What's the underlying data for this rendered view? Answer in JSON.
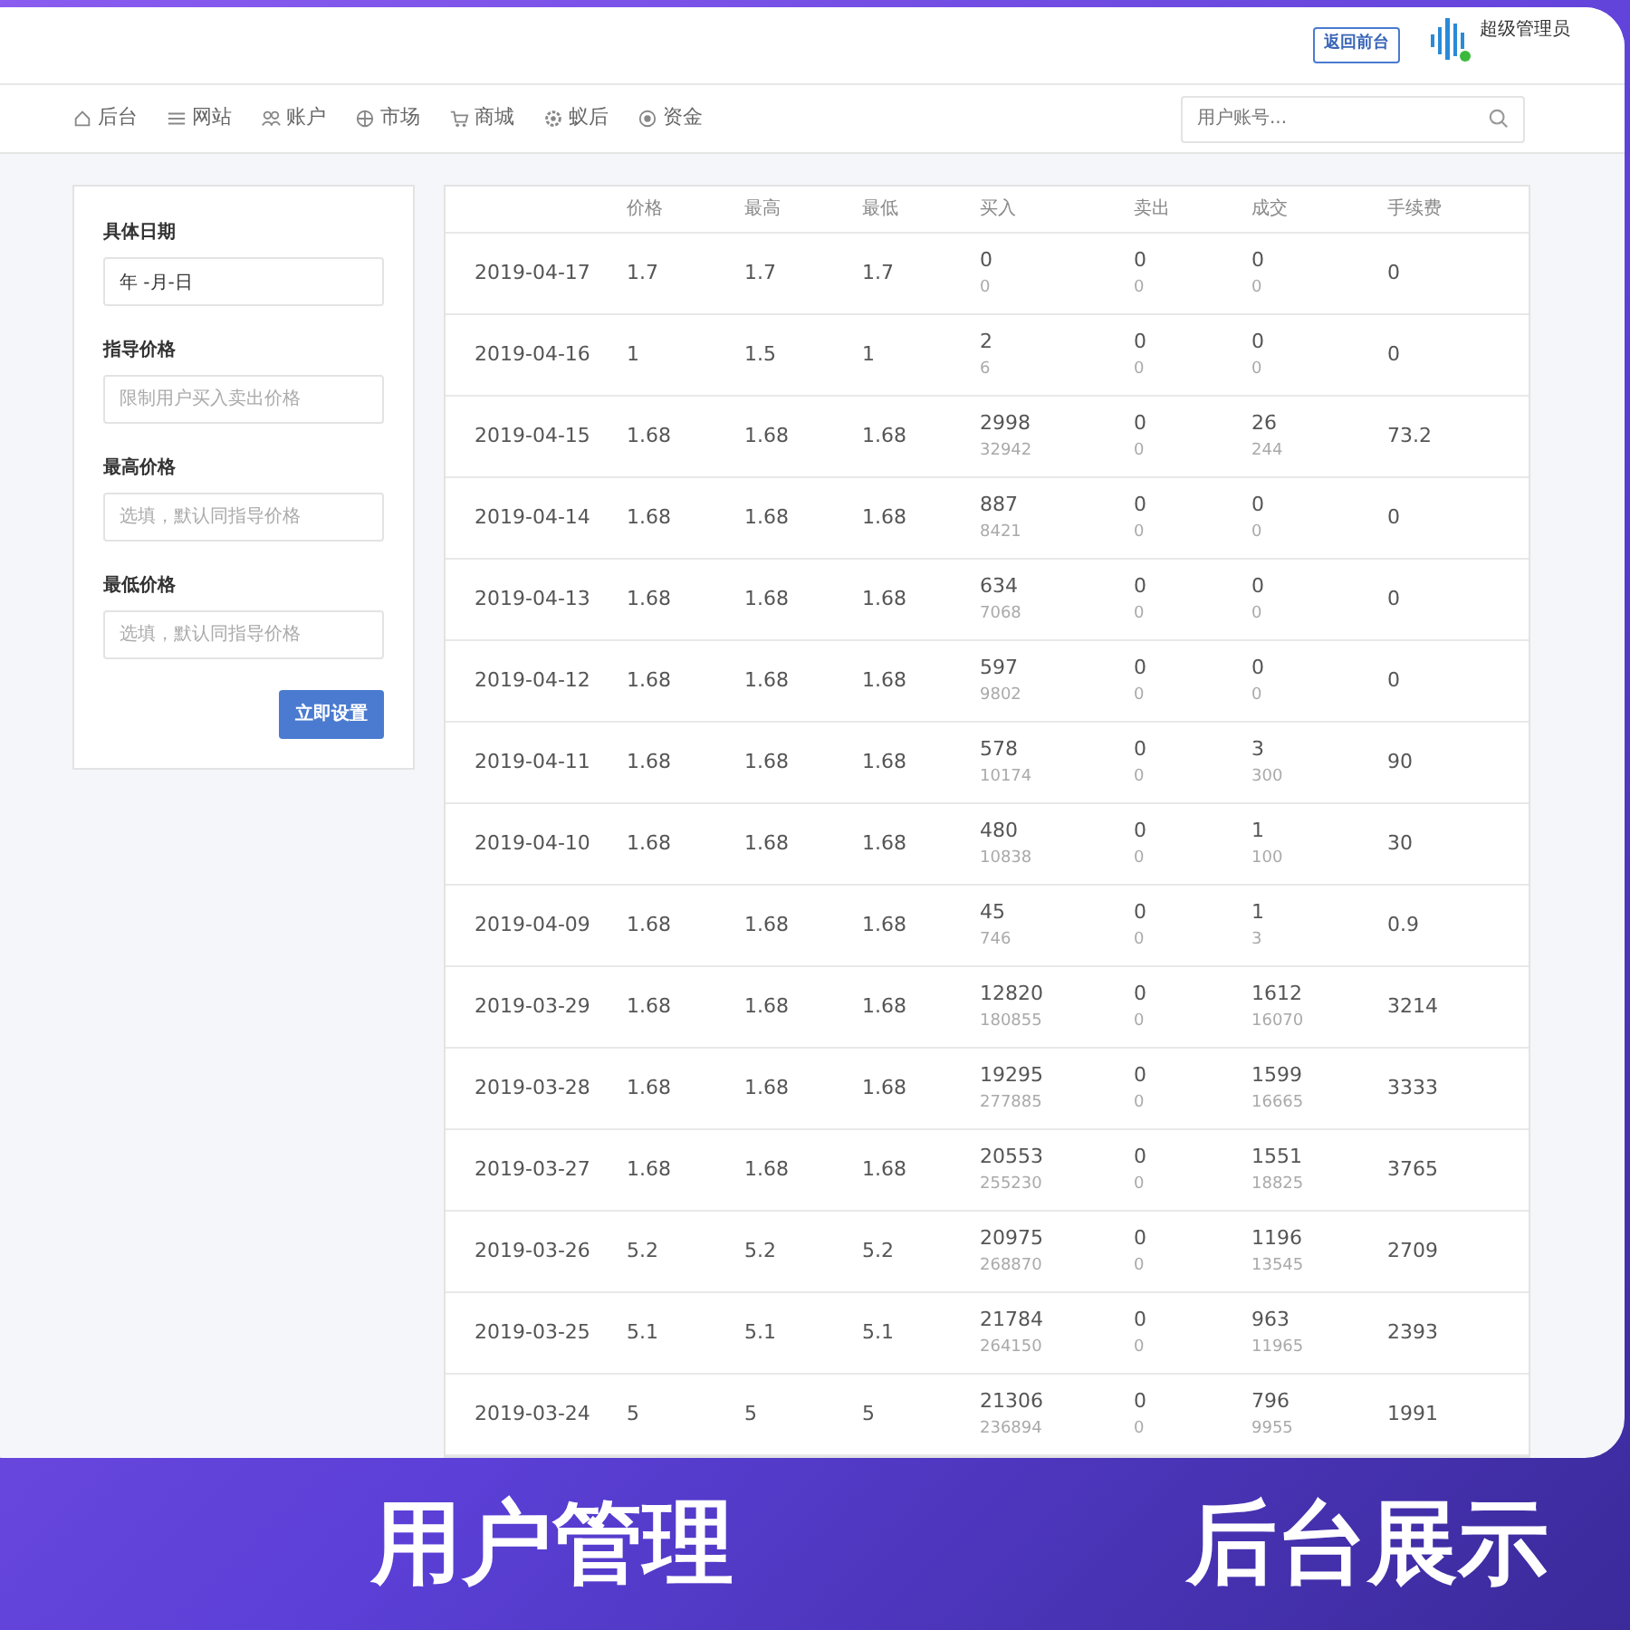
{
  "header": {
    "back_button": "返回前台",
    "user_name": "超级管理员",
    "online": true
  },
  "nav": [
    {
      "label": "后台"
    },
    {
      "label": "网站"
    },
    {
      "label": "账户"
    },
    {
      "label": "市场"
    },
    {
      "label": "商城"
    },
    {
      "label": "蚁后"
    },
    {
      "label": "资金"
    }
  ],
  "search": {
    "placeholder": "用户账号..."
  },
  "form": {
    "fields": [
      {
        "label": "具体日期",
        "value": "年 -月-日"
      },
      {
        "label": "指导价格",
        "placeholder": "限制用户买入卖出价格"
      },
      {
        "label": "最高价格",
        "placeholder": "选填，默认同指导价格"
      },
      {
        "label": "最低价格",
        "placeholder": "选填，默认同指导价格"
      }
    ],
    "submit": "立即设置"
  },
  "table": {
    "columns": [
      "",
      "价格",
      "最高",
      "最低",
      "买入",
      "卖出",
      "成交",
      "手续费"
    ],
    "rows": [
      [
        "2019-04-17",
        "1.7",
        "1.7",
        "1.7",
        [
          "0",
          "0"
        ],
        [
          "0",
          "0"
        ],
        [
          "0",
          "0"
        ],
        "0"
      ],
      [
        "2019-04-16",
        "1",
        "1.5",
        "1",
        [
          "2",
          "6"
        ],
        [
          "0",
          "0"
        ],
        [
          "0",
          "0"
        ],
        "0"
      ],
      [
        "2019-04-15",
        "1.68",
        "1.68",
        "1.68",
        [
          "2998",
          "32942"
        ],
        [
          "0",
          "0"
        ],
        [
          "26",
          "244"
        ],
        "73.2"
      ],
      [
        "2019-04-14",
        "1.68",
        "1.68",
        "1.68",
        [
          "887",
          "8421"
        ],
        [
          "0",
          "0"
        ],
        [
          "0",
          "0"
        ],
        "0"
      ],
      [
        "2019-04-13",
        "1.68",
        "1.68",
        "1.68",
        [
          "634",
          "7068"
        ],
        [
          "0",
          "0"
        ],
        [
          "0",
          "0"
        ],
        "0"
      ],
      [
        "2019-04-12",
        "1.68",
        "1.68",
        "1.68",
        [
          "597",
          "9802"
        ],
        [
          "0",
          "0"
        ],
        [
          "0",
          "0"
        ],
        "0"
      ],
      [
        "2019-04-11",
        "1.68",
        "1.68",
        "1.68",
        [
          "578",
          "10174"
        ],
        [
          "0",
          "0"
        ],
        [
          "3",
          "300"
        ],
        "90"
      ],
      [
        "2019-04-10",
        "1.68",
        "1.68",
        "1.68",
        [
          "480",
          "10838"
        ],
        [
          "0",
          "0"
        ],
        [
          "1",
          "100"
        ],
        "30"
      ],
      [
        "2019-04-09",
        "1.68",
        "1.68",
        "1.68",
        [
          "45",
          "746"
        ],
        [
          "0",
          "0"
        ],
        [
          "1",
          "3"
        ],
        "0.9"
      ],
      [
        "2019-03-29",
        "1.68",
        "1.68",
        "1.68",
        [
          "12820",
          "180855"
        ],
        [
          "0",
          "0"
        ],
        [
          "1612",
          "16070"
        ],
        "3214"
      ],
      [
        "2019-03-28",
        "1.68",
        "1.68",
        "1.68",
        [
          "19295",
          "277885"
        ],
        [
          "0",
          "0"
        ],
        [
          "1599",
          "16665"
        ],
        "3333"
      ],
      [
        "2019-03-27",
        "1.68",
        "1.68",
        "1.68",
        [
          "20553",
          "255230"
        ],
        [
          "0",
          "0"
        ],
        [
          "1551",
          "18825"
        ],
        "3765"
      ],
      [
        "2019-03-26",
        "5.2",
        "5.2",
        "5.2",
        [
          "20975",
          "268870"
        ],
        [
          "0",
          "0"
        ],
        [
          "1196",
          "13545"
        ],
        "2709"
      ],
      [
        "2019-03-25",
        "5.1",
        "5.1",
        "5.1",
        [
          "21784",
          "264150"
        ],
        [
          "0",
          "0"
        ],
        [
          "963",
          "11965"
        ],
        "2393"
      ],
      [
        "2019-03-24",
        "5",
        "5",
        "5",
        [
          "21306",
          "236894"
        ],
        [
          "0",
          "0"
        ],
        [
          "796",
          "9955"
        ],
        "1991"
      ]
    ]
  },
  "banner": [
    "用户管理",
    "后台展示"
  ]
}
